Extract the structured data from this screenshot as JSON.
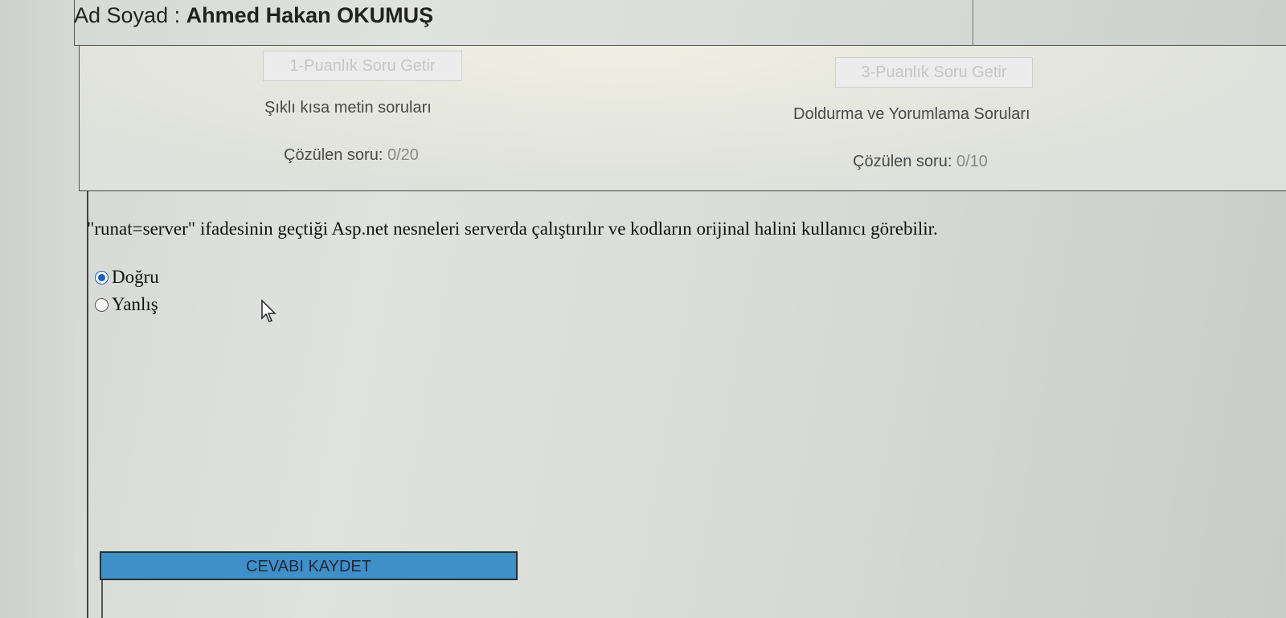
{
  "header": {
    "name_label": "Ad Soyad :",
    "name_value": "Ahmed Hakan OKUMUŞ"
  },
  "categories": [
    {
      "button_label": "1-Puanlık Soru Getir",
      "description": "Şıklı kısa metin soruları",
      "solved_label": "Çözülen soru:",
      "solved_value": "0/20"
    },
    {
      "button_label": "3-Puanlık Soru Getir",
      "description": "Doldurma ve Yorumlama Soruları",
      "solved_label": "Çözülen soru:",
      "solved_value": "0/10"
    }
  ],
  "question": {
    "text": "\"runat=server\" ifadesinin geçtiği Asp.net nesneleri serverda çalıştırılır ve kodların orijinal halini kullanıcı görebilir.",
    "options": [
      {
        "label": "Doğru",
        "selected": true
      },
      {
        "label": "Yanlış",
        "selected": false
      }
    ]
  },
  "save_button_label": "CEVABI KAYDET",
  "colors": {
    "accent_blue": "#3f8fc8",
    "radio_selected": "#1f5fbf"
  },
  "icons": {
    "cursor": "mouse-pointer-icon"
  }
}
